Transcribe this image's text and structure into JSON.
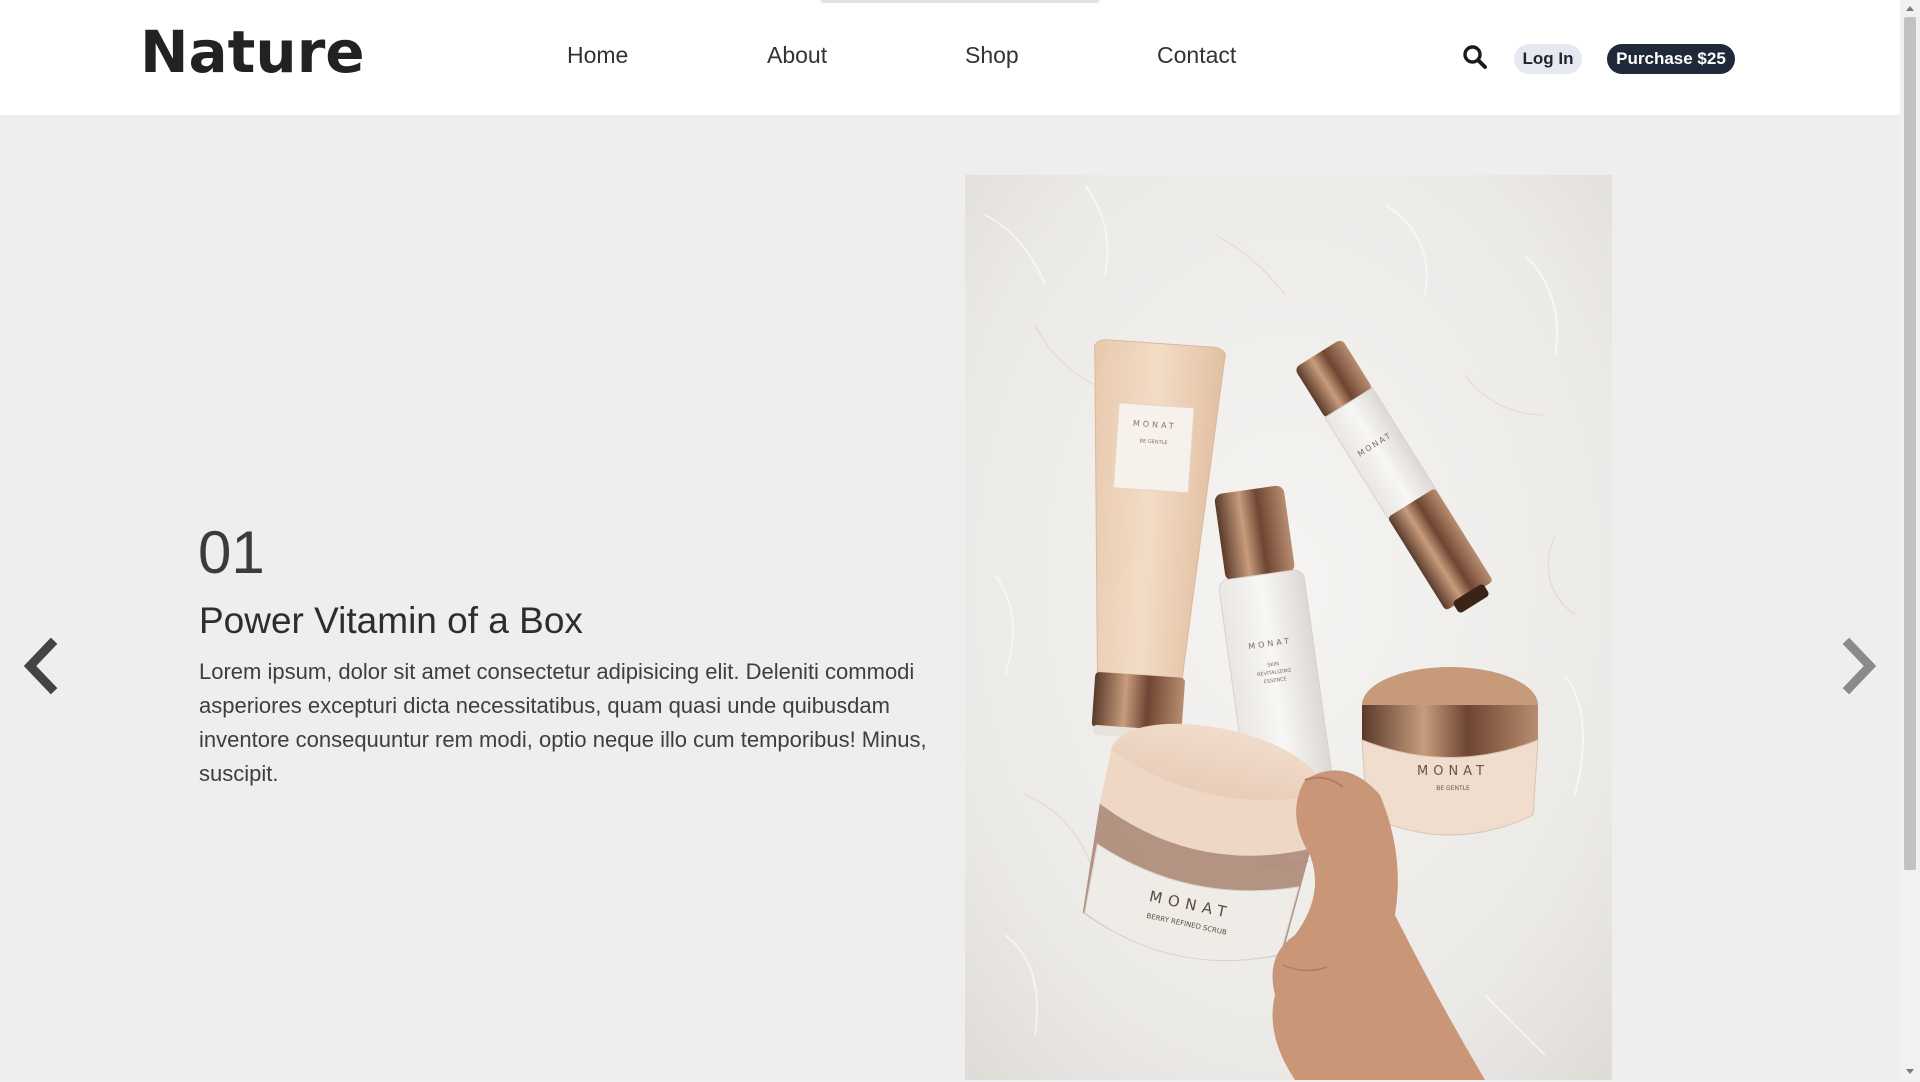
{
  "header": {
    "logo": "Nature",
    "nav": [
      {
        "label": "Home"
      },
      {
        "label": "About"
      },
      {
        "label": "Shop"
      },
      {
        "label": "Contact"
      }
    ],
    "search_icon": "search-icon",
    "login_label": "Log In",
    "purchase_label": "Purchase $25"
  },
  "hero": {
    "slide_number": "01",
    "title": "Power Vitamin of a Box",
    "description": "Lorem ipsum, dolor sit amet consectetur adipisicing elit. Deleniti commodi asperiores excepturi dicta necessitatibus, quam quasi unde quibusdam inventore consequuntur rem modi, optio neque illo cum temporibus! Minus, suscipit.",
    "prev_icon": "chevron-left-icon",
    "next_icon": "chevron-right-icon"
  },
  "product_photo": {
    "brand_marks": [
      "MONAT",
      "MONAT",
      "MONAT",
      "MONAT",
      "MONAT"
    ],
    "product_labels": [
      "BE GENTLE",
      "SKIN REVITALIZING ESSENCE",
      "BE GENTLE",
      "BERRY REFINED SCRUB"
    ]
  },
  "colors": {
    "header_bg": "#ffffff",
    "page_bg": "#eeeeee",
    "text_dark": "#222222",
    "purchase_bg": "#1f2937",
    "login_bg": "#e6eaf0"
  }
}
